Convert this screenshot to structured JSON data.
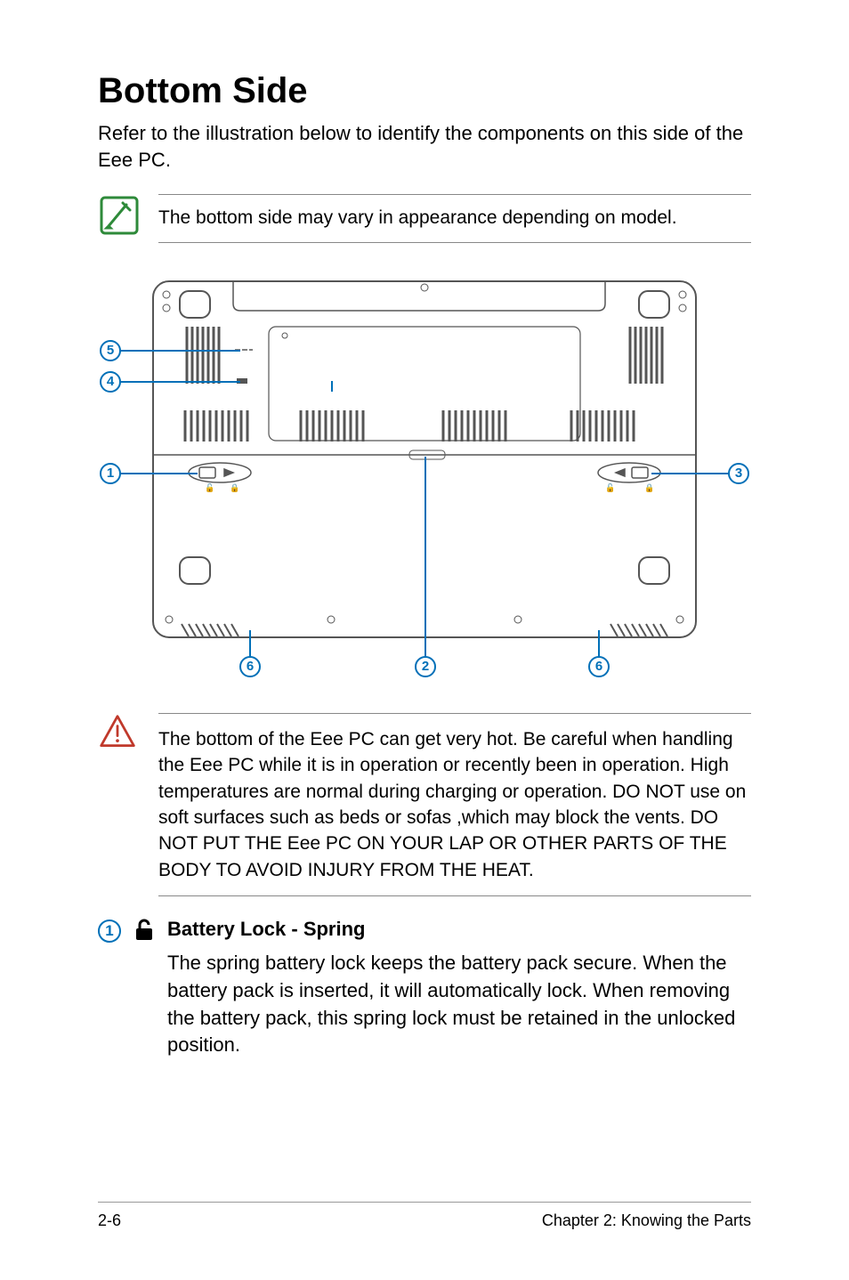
{
  "heading": "Bottom Side",
  "intro": "Refer to the illustration below to identify the components on this side of the Eee PC.",
  "note_text": "The bottom side may vary in appearance depending on model.",
  "callouts": {
    "c1": "1",
    "c2": "2",
    "c3": "3",
    "c4": "4",
    "c5": "5",
    "c6a": "6",
    "c6b": "6"
  },
  "warning_text": "The bottom of the Eee PC can get very hot. Be careful when handling the Eee PC while it is in operation or recently been in operation. High temperatures are normal during charging or operation. DO NOT use on soft surfaces such as beds or sofas ,which may block the vents. DO NOT PUT THE Eee PC ON YOUR LAP OR OTHER PARTS OF THE BODY TO AVOID INJURY FROM THE HEAT.",
  "item1": {
    "number": "1",
    "title": "Battery Lock - Spring",
    "body": "The spring battery lock keeps the battery pack secure. When the battery pack is inserted, it will automatically lock. When removing the battery pack, this spring lock must be retained in the unlocked position."
  },
  "footer": {
    "left": "2-6",
    "right": "Chapter 2: Knowing the Parts"
  }
}
